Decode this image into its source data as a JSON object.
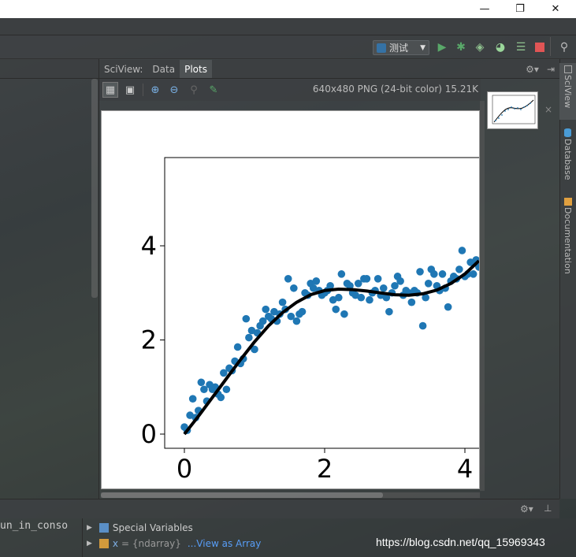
{
  "window": {
    "minimize": "—",
    "restore": "❐",
    "close": "✕"
  },
  "run_toolbar": {
    "config_label": "测试",
    "config_icon": "python-config-icon"
  },
  "sciview": {
    "title": "SciView:",
    "tabs": [
      {
        "label": "Data",
        "active": false
      },
      {
        "label": "Plots",
        "active": true
      }
    ],
    "image_info": "640x480 PNG (24-bit color) 15.21K",
    "thumbnail_close": "×"
  },
  "right_tool_tabs": [
    {
      "label": "SciView",
      "active": true
    },
    {
      "label": "Database",
      "active": false
    },
    {
      "label": "Documentation",
      "active": false
    }
  ],
  "console": {
    "name": "un_in_conso"
  },
  "variables": {
    "rows": [
      {
        "label": "Special Variables",
        "name": "",
        "type": "",
        "action": ""
      },
      {
        "label": "",
        "name": "x",
        "type": "= {ndarray}",
        "action": "...View as Array"
      }
    ]
  },
  "watermark": "https://blog.csdn.net/qq_15969343",
  "colors": {
    "ide_bg": "#3c3f41",
    "accent_blue": "#1f77b4",
    "run_green": "#59a869",
    "stop_red": "#e05555",
    "link": "#589df6"
  },
  "chart_data": {
    "type": "scatter",
    "xticks": [
      "0",
      "2",
      "4"
    ],
    "yticks": [
      "0",
      "2",
      "4"
    ],
    "xlim": [
      -0.3,
      4.3
    ],
    "ylim": [
      -0.3,
      5.8
    ],
    "grid": false,
    "series": [
      {
        "kind": "scatter",
        "color": "#1f77b4",
        "x": [
          0.0,
          0.04,
          0.08,
          0.12,
          0.16,
          0.2,
          0.24,
          0.28,
          0.32,
          0.36,
          0.4,
          0.44,
          0.48,
          0.52,
          0.56,
          0.6,
          0.64,
          0.68,
          0.72,
          0.76,
          0.8,
          0.84,
          0.88,
          0.92,
          0.96,
          1.0,
          1.04,
          1.08,
          1.12,
          1.16,
          1.2,
          1.24,
          1.28,
          1.32,
          1.36,
          1.4,
          1.44,
          1.48,
          1.52,
          1.56,
          1.6,
          1.64,
          1.68,
          1.72,
          1.76,
          1.8,
          1.84,
          1.88,
          1.92,
          1.96,
          2.0,
          2.04,
          2.08,
          2.12,
          2.16,
          2.2,
          2.24,
          2.28,
          2.32,
          2.36,
          2.4,
          2.44,
          2.48,
          2.52,
          2.56,
          2.6,
          2.64,
          2.68,
          2.72,
          2.76,
          2.8,
          2.84,
          2.88,
          2.92,
          2.96,
          3.0,
          3.04,
          3.08,
          3.12,
          3.16,
          3.2,
          3.24,
          3.28,
          3.32,
          3.36,
          3.4,
          3.44,
          3.48,
          3.52,
          3.56,
          3.6,
          3.64,
          3.68,
          3.72,
          3.76,
          3.8,
          3.84,
          3.88,
          3.92,
          3.96,
          4.0,
          4.04,
          4.08,
          4.12,
          4.16,
          4.2
        ],
        "y": [
          0.15,
          0.08,
          0.4,
          0.75,
          0.35,
          0.5,
          1.1,
          0.95,
          0.7,
          1.05,
          0.95,
          1.0,
          0.85,
          0.78,
          1.3,
          0.95,
          1.4,
          1.35,
          1.55,
          1.85,
          1.5,
          1.6,
          2.45,
          2.05,
          2.2,
          1.8,
          2.15,
          2.3,
          2.4,
          2.65,
          2.5,
          2.45,
          2.6,
          2.4,
          2.55,
          2.8,
          2.65,
          3.3,
          2.5,
          3.1,
          2.4,
          2.55,
          2.6,
          3.0,
          2.95,
          3.2,
          3.1,
          3.25,
          3.05,
          2.95,
          3.0,
          3.05,
          3.15,
          2.85,
          2.65,
          2.9,
          3.4,
          2.55,
          3.2,
          3.15,
          3.0,
          2.95,
          3.2,
          2.9,
          3.3,
          3.3,
          2.85,
          3.0,
          3.05,
          3.3,
          2.95,
          3.1,
          2.9,
          2.6,
          3.0,
          3.15,
          3.35,
          3.25,
          2.95,
          3.05,
          3.0,
          2.8,
          3.05,
          3.0,
          3.45,
          2.3,
          2.9,
          3.2,
          3.5,
          3.4,
          3.15,
          3.05,
          3.4,
          3.1,
          2.7,
          3.25,
          3.35,
          3.3,
          3.5,
          3.9,
          3.35,
          3.4,
          3.65,
          3.4,
          3.7,
          3.55
        ]
      },
      {
        "kind": "line",
        "color": "#000000",
        "x": [
          0.0,
          0.2,
          0.4,
          0.6,
          0.8,
          1.0,
          1.2,
          1.4,
          1.6,
          1.8,
          2.0,
          2.2,
          2.4,
          2.6,
          2.8,
          3.0,
          3.2,
          3.4,
          3.6,
          3.8,
          4.0,
          4.2
        ],
        "y": [
          0.0,
          0.38,
          0.78,
          1.18,
          1.58,
          1.96,
          2.3,
          2.58,
          2.8,
          2.96,
          3.05,
          3.08,
          3.07,
          3.04,
          3.0,
          2.96,
          2.95,
          2.98,
          3.06,
          3.2,
          3.4,
          3.68
        ]
      }
    ]
  }
}
